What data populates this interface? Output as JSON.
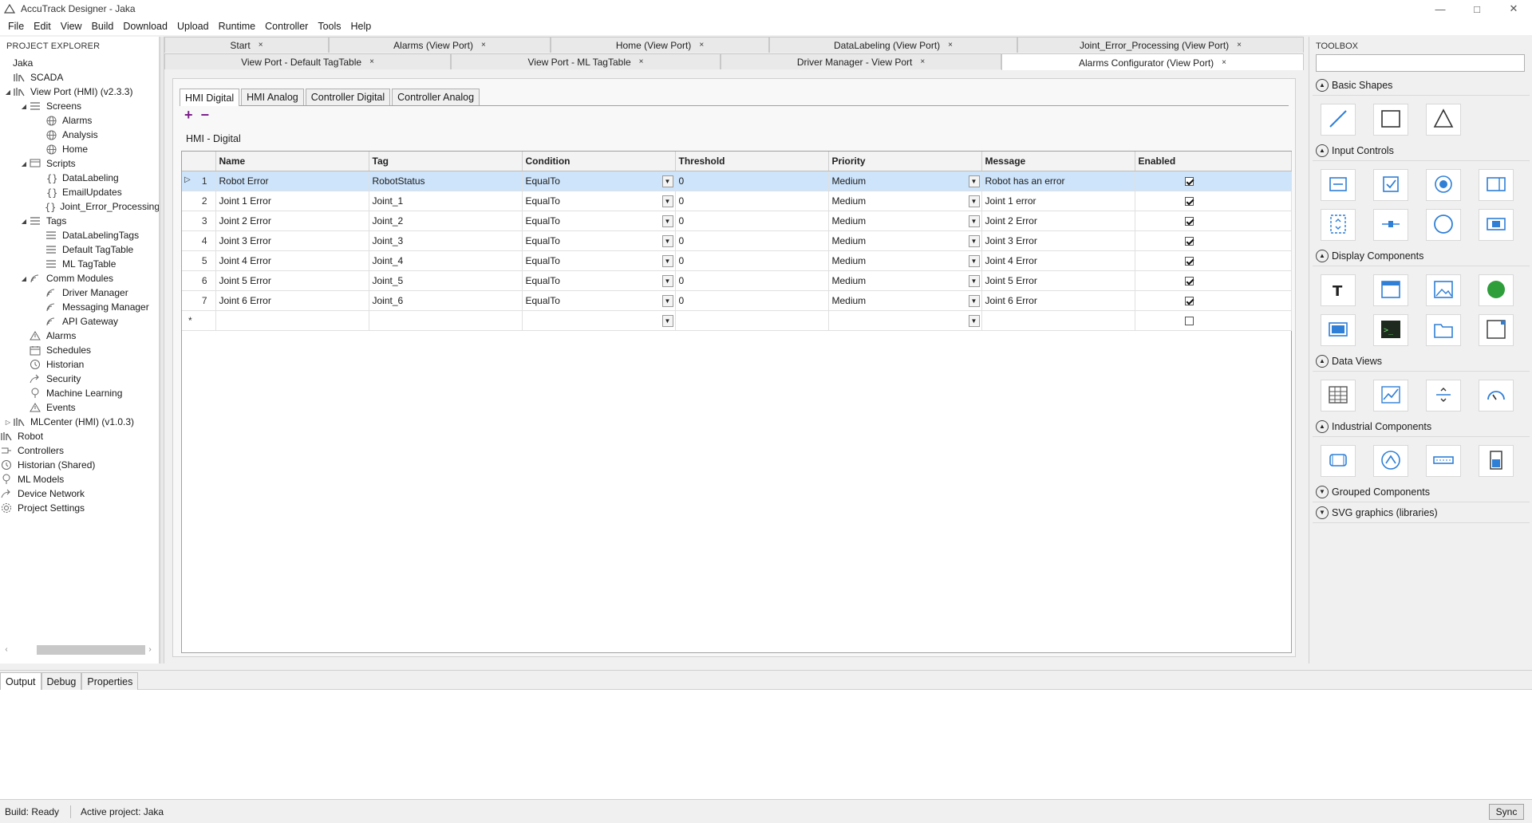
{
  "window": {
    "title": "AccuTrack Designer - Jaka"
  },
  "menu": [
    "File",
    "Edit",
    "View",
    "Build",
    "Download",
    "Upload",
    "Runtime",
    "Controller",
    "Tools",
    "Help"
  ],
  "explorer": {
    "header": "PROJECT EXPLORER",
    "tree": [
      {
        "label": "Jaka",
        "indent": 0,
        "exp": "",
        "icon": "none"
      },
      {
        "label": "SCADA",
        "indent": 0,
        "exp": "",
        "icon": "library"
      },
      {
        "label": "View Port (HMI) (v2.3.3)",
        "indent": 0,
        "exp": "open",
        "icon": "library"
      },
      {
        "label": "Screens",
        "indent": 1,
        "exp": "open",
        "icon": "list"
      },
      {
        "label": "Alarms",
        "indent": 2,
        "exp": "",
        "icon": "globe"
      },
      {
        "label": "Analysis",
        "indent": 2,
        "exp": "",
        "icon": "globe"
      },
      {
        "label": "Home",
        "indent": 2,
        "exp": "",
        "icon": "globe"
      },
      {
        "label": "Scripts",
        "indent": 1,
        "exp": "open",
        "icon": "screen"
      },
      {
        "label": "DataLabeling",
        "indent": 2,
        "exp": "",
        "icon": "braces"
      },
      {
        "label": "EmailUpdates",
        "indent": 2,
        "exp": "",
        "icon": "braces"
      },
      {
        "label": "Joint_Error_Processing",
        "indent": 2,
        "exp": "",
        "icon": "braces"
      },
      {
        "label": "Tags",
        "indent": 1,
        "exp": "open",
        "icon": "list"
      },
      {
        "label": "DataLabelingTags",
        "indent": 2,
        "exp": "",
        "icon": "list"
      },
      {
        "label": "Default TagTable",
        "indent": 2,
        "exp": "",
        "icon": "list"
      },
      {
        "label": "ML TagTable",
        "indent": 2,
        "exp": "",
        "icon": "list"
      },
      {
        "label": "Comm Modules",
        "indent": 1,
        "exp": "open",
        "icon": "signal"
      },
      {
        "label": "Driver Manager",
        "indent": 2,
        "exp": "",
        "icon": "signal"
      },
      {
        "label": "Messaging Manager",
        "indent": 2,
        "exp": "",
        "icon": "signal"
      },
      {
        "label": "API Gateway",
        "indent": 2,
        "exp": "",
        "icon": "signal"
      },
      {
        "label": "Alarms",
        "indent": 1,
        "exp": "",
        "icon": "warning"
      },
      {
        "label": "Schedules",
        "indent": 1,
        "exp": "",
        "icon": "calendar"
      },
      {
        "label": "Historian",
        "indent": 1,
        "exp": "",
        "icon": "history"
      },
      {
        "label": "Security",
        "indent": 1,
        "exp": "",
        "icon": "share"
      },
      {
        "label": "Machine Learning",
        "indent": 1,
        "exp": "",
        "icon": "bulb"
      },
      {
        "label": "Events",
        "indent": 1,
        "exp": "",
        "icon": "warning"
      },
      {
        "label": "MLCenter (HMI) (v1.0.3)",
        "indent": 0,
        "exp": "closed",
        "icon": "library"
      },
      {
        "label": "Robot",
        "indent": -1,
        "exp": "",
        "icon": "library"
      },
      {
        "label": "Controllers",
        "indent": -1,
        "exp": "",
        "icon": "plug"
      },
      {
        "label": "Historian (Shared)",
        "indent": -1,
        "exp": "",
        "icon": "history"
      },
      {
        "label": "ML Models",
        "indent": -1,
        "exp": "",
        "icon": "bulb"
      },
      {
        "label": "Device Network",
        "indent": -1,
        "exp": "",
        "icon": "share"
      },
      {
        "label": "Project Settings",
        "indent": -1,
        "exp": "",
        "icon": "gear"
      }
    ]
  },
  "doc_tabs": {
    "row1": [
      {
        "label": "Start",
        "width": 206
      },
      {
        "label": "Alarms (View Port)",
        "width": 278
      },
      {
        "label": "Home (View Port)",
        "width": 274
      },
      {
        "label": "DataLabeling (View Port)",
        "width": 311
      },
      {
        "label": "Joint_Error_Processing (View Port)",
        "width": 359
      }
    ],
    "row2": [
      {
        "label": "View Port - Default TagTable",
        "width": 359
      },
      {
        "label": "View Port - ML TagTable",
        "width": 338
      },
      {
        "label": "Driver Manager - View Port",
        "width": 352
      },
      {
        "label": "Alarms Configurator (View Port)",
        "width": 379,
        "active": true
      }
    ]
  },
  "editor": {
    "sub_tabs": [
      "HMI Digital",
      "HMI Analog",
      "Controller Digital",
      "Controller Analog"
    ],
    "add_symbol": "+",
    "remove_symbol": "−",
    "section_title": "HMI - Digital",
    "columns": [
      "Name",
      "Tag",
      "Condition",
      "Threshold",
      "Priority",
      "Message",
      "Enabled"
    ],
    "rows": [
      {
        "num": "1",
        "name": "Robot Error",
        "tag": "RobotStatus",
        "condition": "EqualTo",
        "threshold": "0",
        "priority": "Medium",
        "message": "Robot has an error",
        "enabled": true
      },
      {
        "num": "2",
        "name": "Joint 1 Error",
        "tag": "Joint_1",
        "condition": "EqualTo",
        "threshold": "0",
        "priority": "Medium",
        "message": "Joint 1 error",
        "enabled": true
      },
      {
        "num": "3",
        "name": "Joint 2 Error",
        "tag": "Joint_2",
        "condition": "EqualTo",
        "threshold": "0",
        "priority": "Medium",
        "message": "Joint 2 Error",
        "enabled": true
      },
      {
        "num": "4",
        "name": "Joint 3 Error",
        "tag": "Joint_3",
        "condition": "EqualTo",
        "threshold": "0",
        "priority": "Medium",
        "message": "Joint 3 Error",
        "enabled": true
      },
      {
        "num": "5",
        "name": "Joint 4 Error",
        "tag": "Joint_4",
        "condition": "EqualTo",
        "threshold": "0",
        "priority": "Medium",
        "message": "Joint 4 Error",
        "enabled": true
      },
      {
        "num": "6",
        "name": "Joint 5 Error",
        "tag": "Joint_5",
        "condition": "EqualTo",
        "threshold": "0",
        "priority": "Medium",
        "message": "Joint 5 Error",
        "enabled": true
      },
      {
        "num": "7",
        "name": "Joint 6 Error",
        "tag": "Joint_6",
        "condition": "EqualTo",
        "threshold": "0",
        "priority": "Medium",
        "message": "Joint 6 Error",
        "enabled": true
      }
    ],
    "new_row_marker": "*",
    "selected_row": 0
  },
  "toolbox": {
    "header": "TOOLBOX",
    "sections": [
      {
        "label": "Basic Shapes",
        "expanded": true,
        "items": [
          "line-icon",
          "rectangle-icon",
          "triangle-icon"
        ]
      },
      {
        "label": "Input Controls",
        "expanded": true,
        "items": [
          "textbox-icon",
          "checkbox-icon",
          "radio-icon",
          "dropdown-icon",
          "spinner-icon",
          "slider-icon",
          "circle-icon",
          "button-icon"
        ]
      },
      {
        "label": "Display Components",
        "expanded": true,
        "items": [
          "text-icon",
          "window-icon",
          "image-icon",
          "indicator-icon",
          "panel-icon",
          "terminal-icon",
          "folder-icon",
          "frame-icon"
        ]
      },
      {
        "label": "Data Views",
        "expanded": true,
        "items": [
          "table-icon",
          "trend-icon",
          "divider-icon",
          "gauge-icon"
        ]
      },
      {
        "label": "Industrial Components",
        "expanded": true,
        "items": [
          "tank-icon",
          "pump-icon",
          "conveyor-icon",
          "level-icon"
        ]
      },
      {
        "label": "Grouped Components",
        "expanded": false,
        "items": []
      },
      {
        "label": "SVG graphics (libraries)",
        "expanded": false,
        "items": []
      }
    ]
  },
  "bottom_tabs": [
    "Output",
    "Debug",
    "Properties"
  ],
  "status": {
    "build": "Build: Ready",
    "project": "Active project: Jaka",
    "sync_label": "Sync"
  },
  "colors": {
    "accent": "#2f7fd6",
    "add_remove": "#7a1f8a",
    "selected_row": "#cde4fb"
  }
}
